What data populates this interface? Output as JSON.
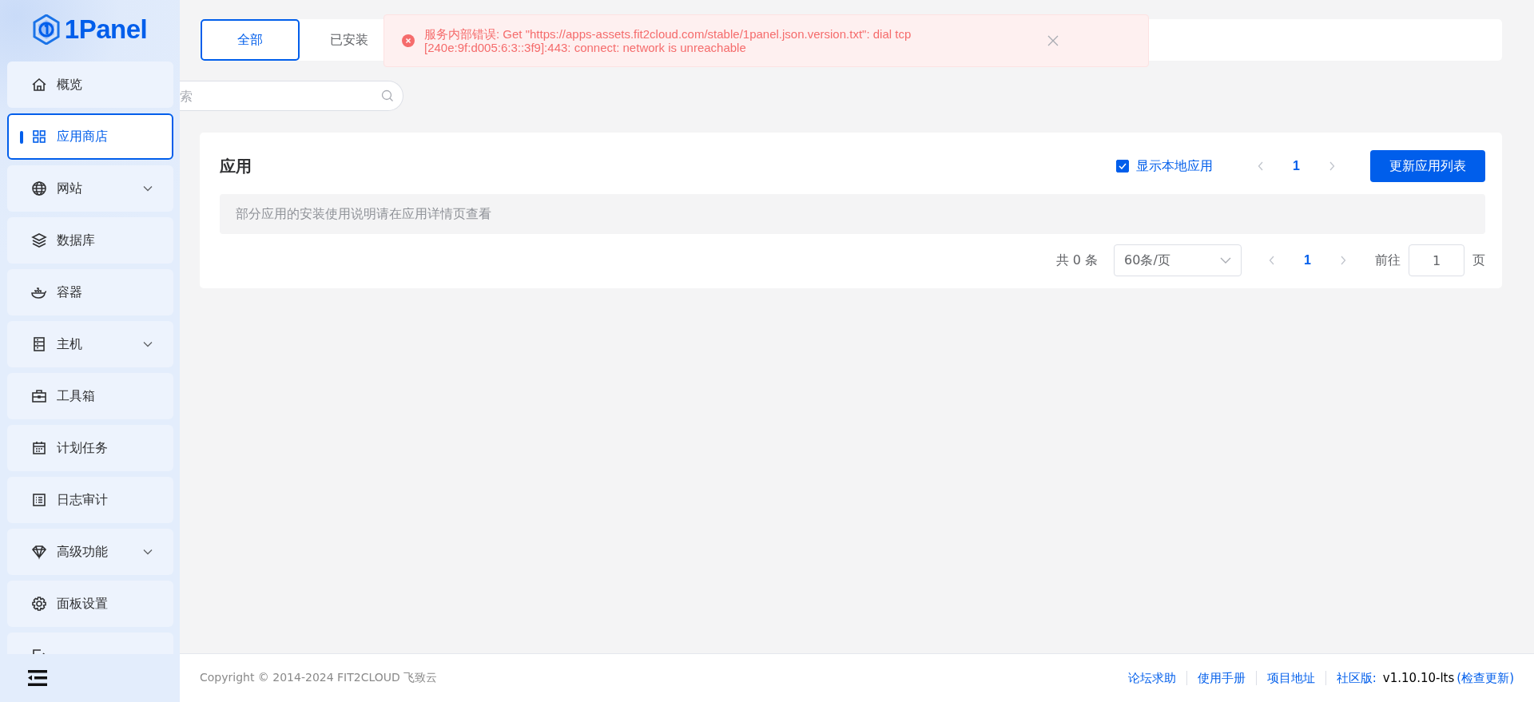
{
  "sidebar": {
    "logo": "1Panel",
    "items": [
      {
        "label": "概览",
        "kind": "link",
        "selected": false
      },
      {
        "label": "应用商店",
        "kind": "link",
        "selected": true
      },
      {
        "label": "网站",
        "kind": "group",
        "selected": false
      },
      {
        "label": "数据库",
        "kind": "link",
        "selected": false
      },
      {
        "label": "容器",
        "kind": "link",
        "selected": false
      },
      {
        "label": "主机",
        "kind": "group",
        "selected": false
      },
      {
        "label": "工具箱",
        "kind": "link",
        "selected": false
      },
      {
        "label": "计划任务",
        "kind": "link",
        "selected": false
      },
      {
        "label": "日志审计",
        "kind": "link",
        "selected": false
      },
      {
        "label": "高级功能",
        "kind": "group",
        "selected": false
      },
      {
        "label": "面板设置",
        "kind": "link",
        "selected": false
      },
      {
        "kind": "link",
        "selected": false
      }
    ]
  },
  "tabs": [
    {
      "label": "全部",
      "selected": true
    },
    {
      "label": "已安装",
      "selected": false
    }
  ],
  "toast": {
    "kind": "error",
    "message": "服务内部错误: Get \"https://apps-assets.fit2cloud.com/stable/1panel.json.version.txt\": dial tcp [240e:9f:d005:6:3::3f9]:443: connect: network is unreachable"
  },
  "search": {
    "placeholder": "索"
  },
  "apps": {
    "title": "应用",
    "show_local": {
      "label": "显示本地应用",
      "checked": true
    },
    "top_page": "1",
    "update_button": "更新应用列表",
    "notice": "部分应用的安装使用说明请在应用详情页查看",
    "pagination": {
      "total": "共 0 条",
      "page_size": "60条/页",
      "page": "1",
      "goto_label": "前往",
      "goto_value": "1",
      "page_suffix": "页"
    }
  },
  "footer": {
    "copyright": "Copyright © 2014-2024 FIT2CLOUD 飞致云",
    "links": [
      "论坛求助",
      "使用手册",
      "项目地址"
    ],
    "edition_label": "社区版:",
    "version": "v1.10.10-lts",
    "check_update": "(检查更新)"
  }
}
